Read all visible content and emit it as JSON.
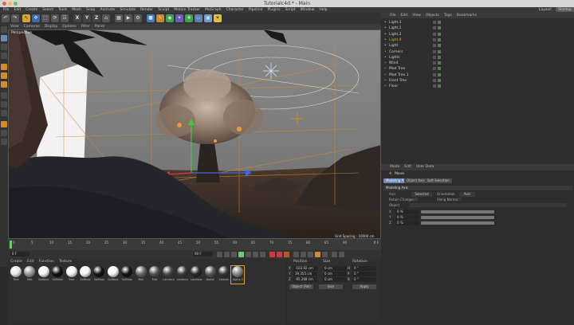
{
  "window": {
    "title": "Tutorialc4d.* - Main"
  },
  "menubar": [
    "File",
    "Edit",
    "Create",
    "Select",
    "Tools",
    "Mesh",
    "Snap",
    "Animate",
    "Simulate",
    "Render",
    "Sculpt",
    "Motion Tracker",
    "MoGraph",
    "Character",
    "Pipeline",
    "Plugins",
    "Script",
    "Window",
    "Help"
  ],
  "layout": {
    "label": "Layout:",
    "value": "Startup"
  },
  "toolbar": {
    "x": "X",
    "y": "Y",
    "z": "Z"
  },
  "viewport_menu": [
    "View",
    "Cameras",
    "Display",
    "Options",
    "Filter",
    "Panel"
  ],
  "viewport": {
    "label": "Perspective",
    "grid_spacing": "Grid Spacing : 10000 cm"
  },
  "timeline": {
    "ticks": [
      "0",
      "5",
      "10",
      "15",
      "20",
      "25",
      "30",
      "35",
      "40",
      "45",
      "50",
      "55",
      "60",
      "65",
      "70",
      "75",
      "80",
      "85",
      "90"
    ],
    "frame_readout": "0 F"
  },
  "transport": {
    "start": "0 F",
    "end": "90 F",
    "current": "0 F",
    "end2": "90 F"
  },
  "objects_menu": [
    "File",
    "Edit",
    "View",
    "Objects",
    "Tags",
    "Bookmarks"
  ],
  "objects": [
    {
      "name": "Light.3",
      "sel": false
    },
    {
      "name": "Light.1",
      "sel": false
    },
    {
      "name": "Light.2",
      "sel": false
    },
    {
      "name": "Light.4",
      "sel": true
    },
    {
      "name": "Light",
      "sel": false
    },
    {
      "name": "Corners",
      "sel": false
    },
    {
      "name": "Lights",
      "sel": false
    },
    {
      "name": "Wind",
      "sel": false
    },
    {
      "name": "Mad Tree",
      "sel": false
    },
    {
      "name": "Mad Tree.1",
      "sel": false
    },
    {
      "name": "Front Tree",
      "sel": false
    },
    {
      "name": "Floor",
      "sel": false
    }
  ],
  "attributes": {
    "menu": [
      "Mode",
      "Edit",
      "User Data"
    ],
    "title": "Move",
    "tabs": [
      "Modeling Axis",
      "Object Axis",
      "Soft Selection"
    ],
    "section": "Modeling Axis",
    "axis_label": "Axis",
    "axis_value": "Selected",
    "orientation_label": "Orientation",
    "orientation_value": "Axis",
    "retain_label": "Retain Changes",
    "along_label": "Along Normals",
    "object_label": "Object",
    "rows": [
      {
        "axis": "X",
        "value": "0 %"
      },
      {
        "axis": "Y",
        "value": "0 %"
      },
      {
        "axis": "Z",
        "value": "0 %"
      }
    ]
  },
  "materials": {
    "menu": [
      "Create",
      "Edit",
      "Function",
      "Texture"
    ],
    "items": [
      {
        "name": "Tree",
        "color": "#e8e8e8"
      },
      {
        "name": "Mat",
        "color": "#9a9a9a"
      },
      {
        "name": "Softbox",
        "color": "#f4f4f4"
      },
      {
        "name": "Softbox",
        "color": "#111111"
      },
      {
        "name": "Tree",
        "color": "#f4f4f4"
      },
      {
        "name": "Softbox",
        "color": "#f4f4f4"
      },
      {
        "name": "Softbox",
        "color": "#151515"
      },
      {
        "name": "Softbox",
        "color": "#f4f4f4"
      },
      {
        "name": "Softbox",
        "color": "#151515"
      },
      {
        "name": "Mat",
        "color": "#6a6a6a"
      },
      {
        "name": "Mat",
        "color": "#555555"
      },
      {
        "name": "Landsca",
        "color": "#4a4a4a"
      },
      {
        "name": "Landsca",
        "color": "#3d3d3d"
      },
      {
        "name": "Landsca",
        "color": "#2a2a2a"
      },
      {
        "name": "Alpha",
        "color": "#5a5a5a"
      },
      {
        "name": "Leaves",
        "color": "#3a3a3a"
      },
      {
        "name": "Alpha.1",
        "color": "#888888"
      }
    ]
  },
  "coordinates": {
    "headers": {
      "position": "Position",
      "size": "Size",
      "rotation": "Rotation"
    },
    "rows": [
      {
        "axis": "X",
        "pos": "-103.92 cm",
        "size": "0 cm",
        "rot_label": "H",
        "rot": "0 °"
      },
      {
        "axis": "Y",
        "pos": "39.355 cm",
        "size": "0 cm",
        "rot_label": "P",
        "rot": "0 °"
      },
      {
        "axis": "Z",
        "pos": "-95.288 cm",
        "size": "0 cm",
        "rot_label": "B",
        "rot": "0 °"
      }
    ],
    "mode_value": "Object (Rel)",
    "size_mode": "Size",
    "apply": "Apply"
  },
  "colors": {
    "accent": "#e08a1e",
    "selected": "#e0a030"
  }
}
